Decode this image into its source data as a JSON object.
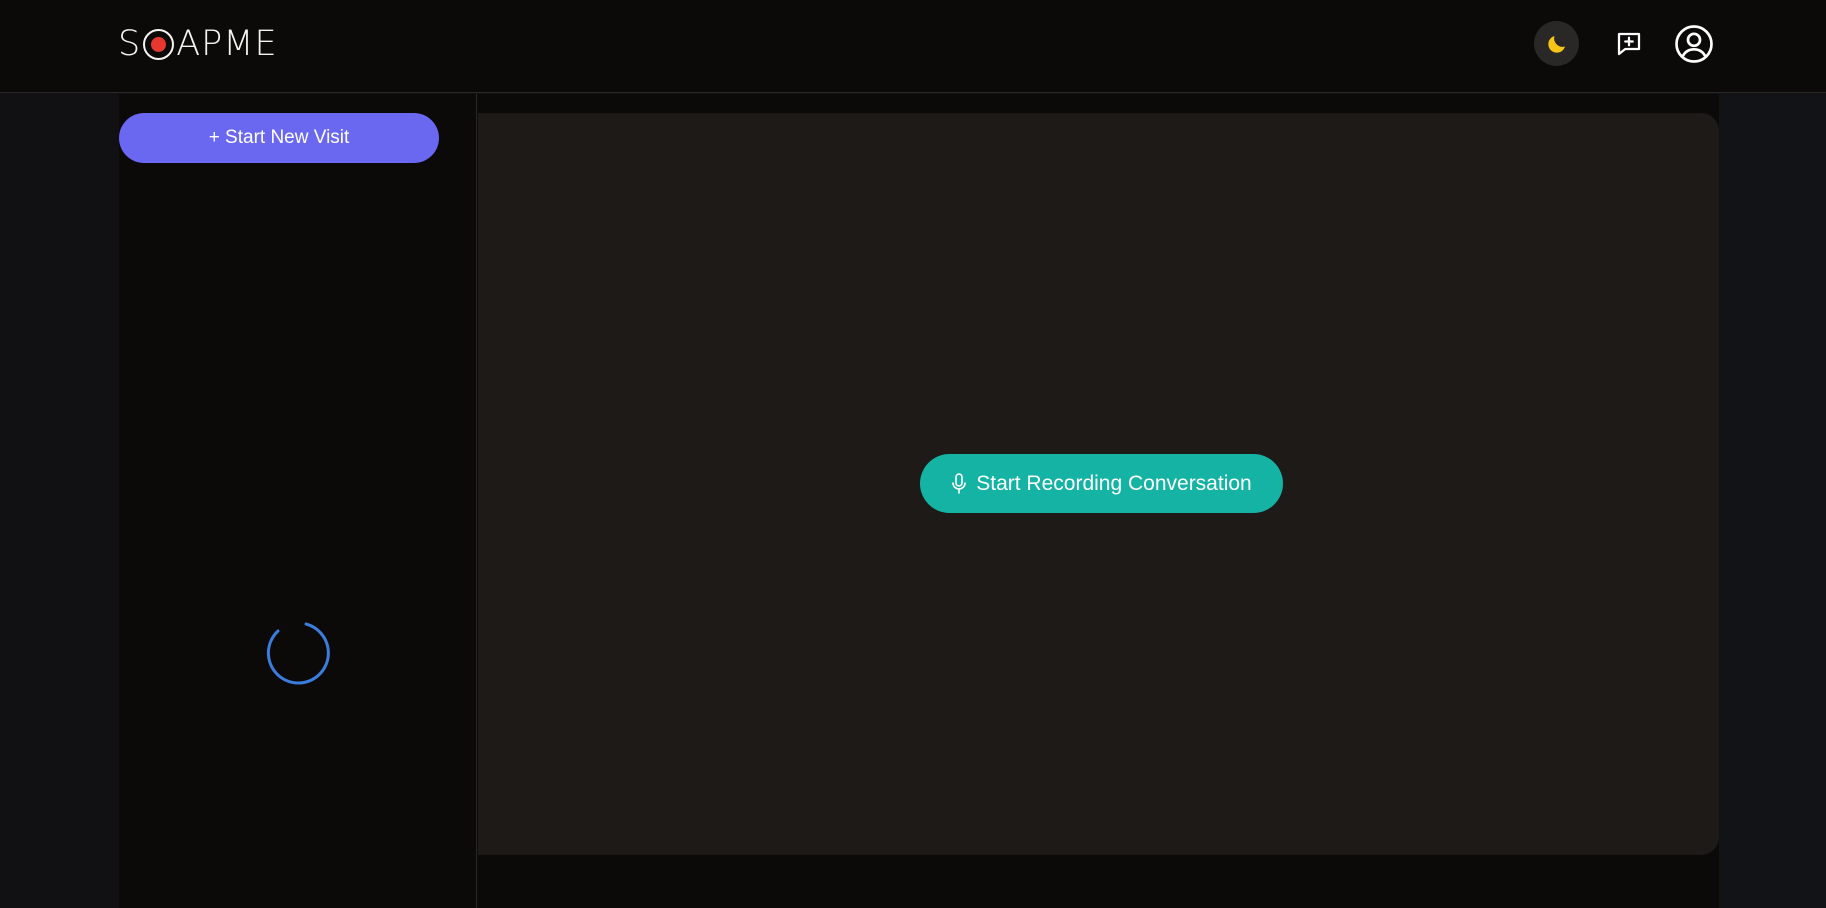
{
  "header": {
    "logo": {
      "text_before": "S",
      "text_after": "APME",
      "dot_color": "#e8372f"
    },
    "theme_toggle": {
      "icon": "moon-icon",
      "icon_color": "#f5c518"
    },
    "feedback": {
      "icon": "message-plus-icon"
    },
    "account": {
      "icon": "user-circle-icon"
    }
  },
  "sidebar": {
    "new_visit_label": "+ Start New Visit",
    "loading_icon": "spinner-icon",
    "accent_color": "#6a67f0"
  },
  "main": {
    "record_button_label": "Start Recording Conversation",
    "record_icon": "microphone-icon",
    "accent_color": "#14b3a4"
  }
}
